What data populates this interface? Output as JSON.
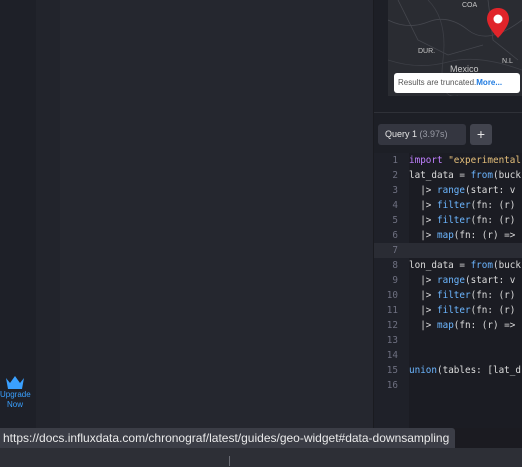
{
  "sidebar": {
    "upgrade_label_line1": "Upgrade",
    "upgrade_label_line2": "Now",
    "upgrade_icon": "crown-icon"
  },
  "map": {
    "labels": [
      "COA",
      "DUR.",
      "Mexico",
      "N.L"
    ],
    "truncated_text": "Results are truncated.",
    "more_label": "More..."
  },
  "query_tab": {
    "label": "Query 1",
    "time": "(3.97s)",
    "add_label": "+"
  },
  "editor": {
    "lines": [
      {
        "n": "1",
        "parts": [
          [
            "k",
            "import"
          ],
          [
            "c",
            " "
          ],
          [
            "s",
            "\"experimental"
          ]
        ]
      },
      {
        "n": "2",
        "parts": [
          [
            "c",
            "lat_data = "
          ],
          [
            "f",
            "from"
          ],
          [
            "c",
            "(buck"
          ]
        ]
      },
      {
        "n": "3",
        "parts": [
          [
            "c",
            "  |> "
          ],
          [
            "f",
            "range"
          ],
          [
            "c",
            "(start: v"
          ]
        ]
      },
      {
        "n": "4",
        "parts": [
          [
            "c",
            "  |> "
          ],
          [
            "f",
            "filter"
          ],
          [
            "c",
            "(fn: (r)"
          ]
        ]
      },
      {
        "n": "5",
        "parts": [
          [
            "c",
            "  |> "
          ],
          [
            "f",
            "filter"
          ],
          [
            "c",
            "(fn: (r)"
          ]
        ]
      },
      {
        "n": "6",
        "parts": [
          [
            "c",
            "  |> "
          ],
          [
            "f",
            "map"
          ],
          [
            "c",
            "(fn: (r) =>"
          ]
        ]
      },
      {
        "n": "7",
        "parts": []
      },
      {
        "n": "8",
        "parts": [
          [
            "c",
            "lon_data = "
          ],
          [
            "f",
            "from"
          ],
          [
            "c",
            "(buck"
          ]
        ]
      },
      {
        "n": "9",
        "parts": [
          [
            "c",
            "  |> "
          ],
          [
            "f",
            "range"
          ],
          [
            "c",
            "(start: v"
          ]
        ]
      },
      {
        "n": "10",
        "parts": [
          [
            "c",
            "  |> "
          ],
          [
            "f",
            "filter"
          ],
          [
            "c",
            "(fn: (r)"
          ]
        ]
      },
      {
        "n": "11",
        "parts": [
          [
            "c",
            "  |> "
          ],
          [
            "f",
            "filter"
          ],
          [
            "c",
            "(fn: (r)"
          ]
        ]
      },
      {
        "n": "12",
        "parts": [
          [
            "c",
            "  |> "
          ],
          [
            "f",
            "map"
          ],
          [
            "c",
            "(fn: (r) =>"
          ]
        ]
      },
      {
        "n": "13",
        "parts": []
      },
      {
        "n": "14",
        "parts": []
      },
      {
        "n": "15",
        "parts": [
          [
            "f",
            "union"
          ],
          [
            "c",
            "(tables: [lat_d"
          ]
        ]
      },
      {
        "n": "16",
        "parts": []
      }
    ]
  },
  "status_url": "https://docs.influxdata.com/chronograf/latest/guides/geo-widget#data-downsampling"
}
